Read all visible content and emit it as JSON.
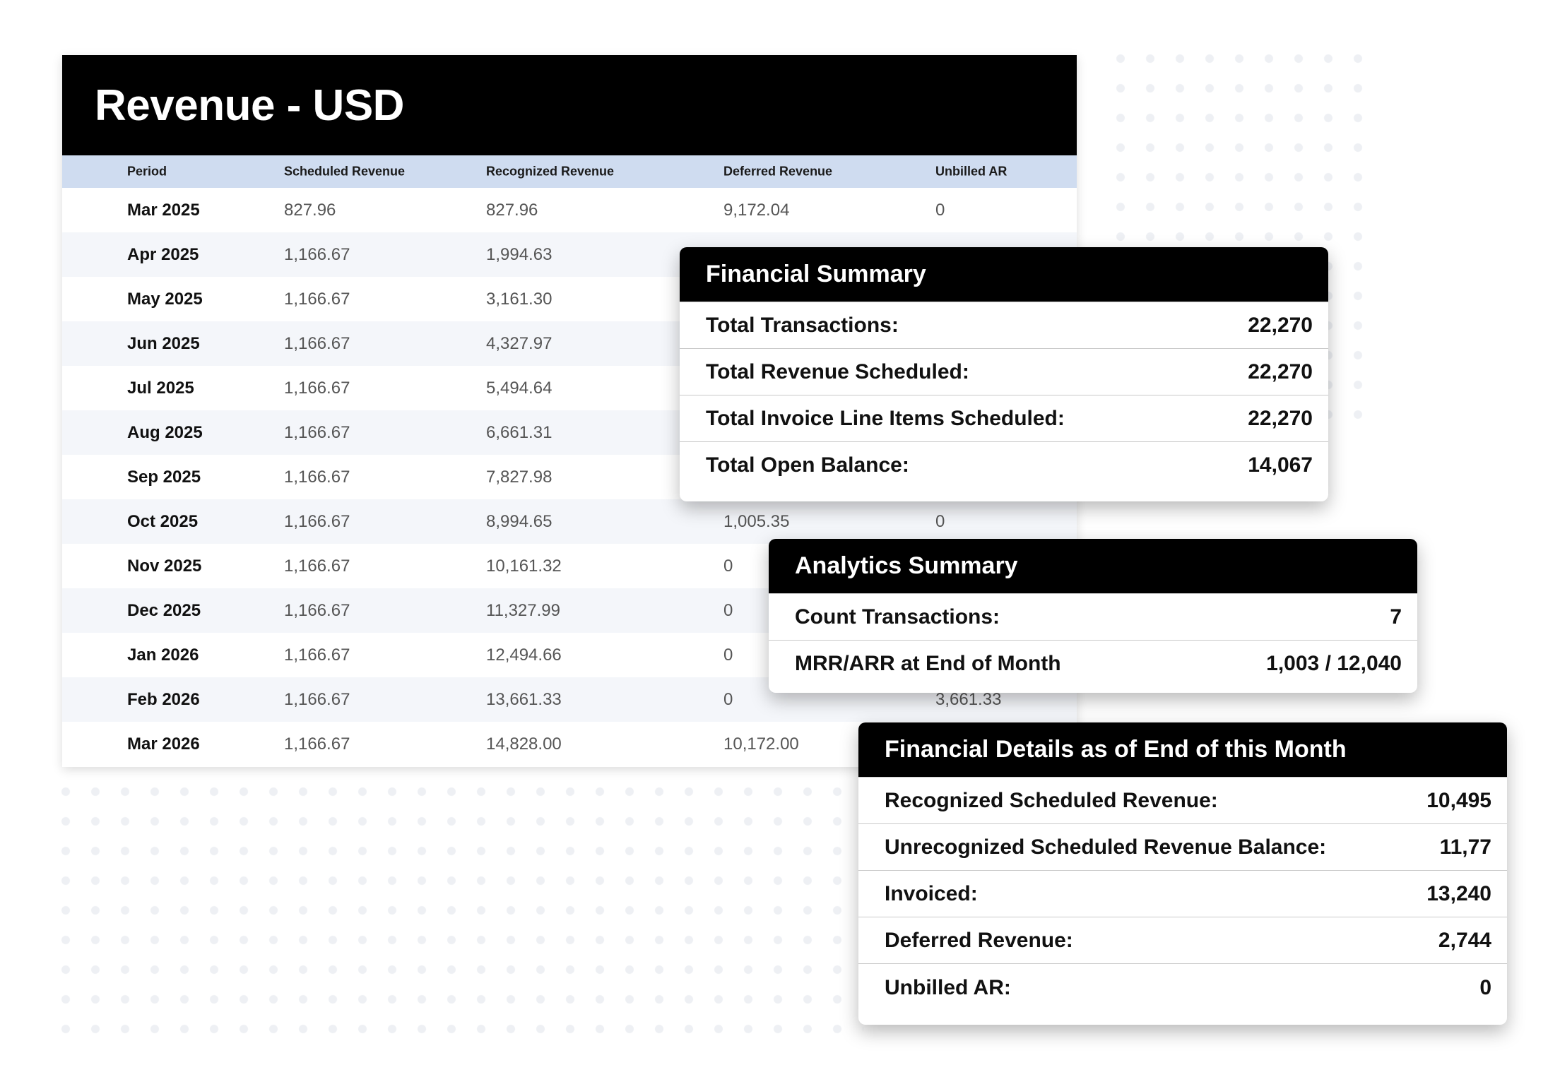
{
  "revenue_table": {
    "title": "Revenue - USD",
    "columns": [
      "Period",
      "Scheduled Revenue",
      "Recognized Revenue",
      "Deferred Revenue",
      "Unbilled AR"
    ],
    "rows": [
      [
        "Mar 2025",
        "827.96",
        "827.96",
        "9,172.04",
        "0"
      ],
      [
        "Apr 2025",
        "1,166.67",
        "1,994.63",
        "",
        ""
      ],
      [
        "May 2025",
        "1,166.67",
        "3,161.30",
        "",
        ""
      ],
      [
        "Jun 2025",
        "1,166.67",
        "4,327.97",
        "",
        ""
      ],
      [
        "Jul 2025",
        "1,166.67",
        "5,494.64",
        "",
        ""
      ],
      [
        "Aug 2025",
        "1,166.67",
        "6,661.31",
        "",
        ""
      ],
      [
        "Sep 2025",
        "1,166.67",
        "7,827.98",
        "",
        ""
      ],
      [
        "Oct 2025",
        "1,166.67",
        "8,994.65",
        "1,005.35",
        "0"
      ],
      [
        "Nov 2025",
        "1,166.67",
        "10,161.32",
        "0",
        ""
      ],
      [
        "Dec 2025",
        "1,166.67",
        "11,327.99",
        "0",
        ""
      ],
      [
        "Jan 2026",
        "1,166.67",
        "12,494.66",
        "0",
        ""
      ],
      [
        "Feb 2026",
        "1,166.67",
        "13,661.33",
        "0",
        "3,661.33"
      ],
      [
        "Mar 2026",
        "1,166.67",
        "14,828.00",
        "10,172.00",
        ""
      ]
    ]
  },
  "financial_summary": {
    "title": "Financial Summary",
    "rows": [
      {
        "label": "Total Transactions:",
        "value": "22,270"
      },
      {
        "label": "Total Revenue Scheduled:",
        "value": "22,270"
      },
      {
        "label": "Total Invoice Line Items Scheduled:",
        "value": "22,270"
      },
      {
        "label": "Total Open Balance:",
        "value": "14,067"
      }
    ]
  },
  "analytics_summary": {
    "title": "Analytics Summary",
    "rows": [
      {
        "label": "Count Transactions:",
        "value": "7"
      },
      {
        "label": "MRR/ARR at End of Month",
        "value": "1,003 / 12,040"
      }
    ]
  },
  "financial_details": {
    "title": "Financial Details as of End of this Month",
    "rows": [
      {
        "label": "Recognized Scheduled Revenue:",
        "value": "10,495"
      },
      {
        "label": "Unrecognized Scheduled Revenue Balance:",
        "value": "11,77"
      },
      {
        "label": "Invoiced:",
        "value": "13,240"
      },
      {
        "label": "Deferred Revenue:",
        "value": "2,744"
      },
      {
        "label": "Unbilled AR:",
        "value": "0"
      }
    ]
  }
}
